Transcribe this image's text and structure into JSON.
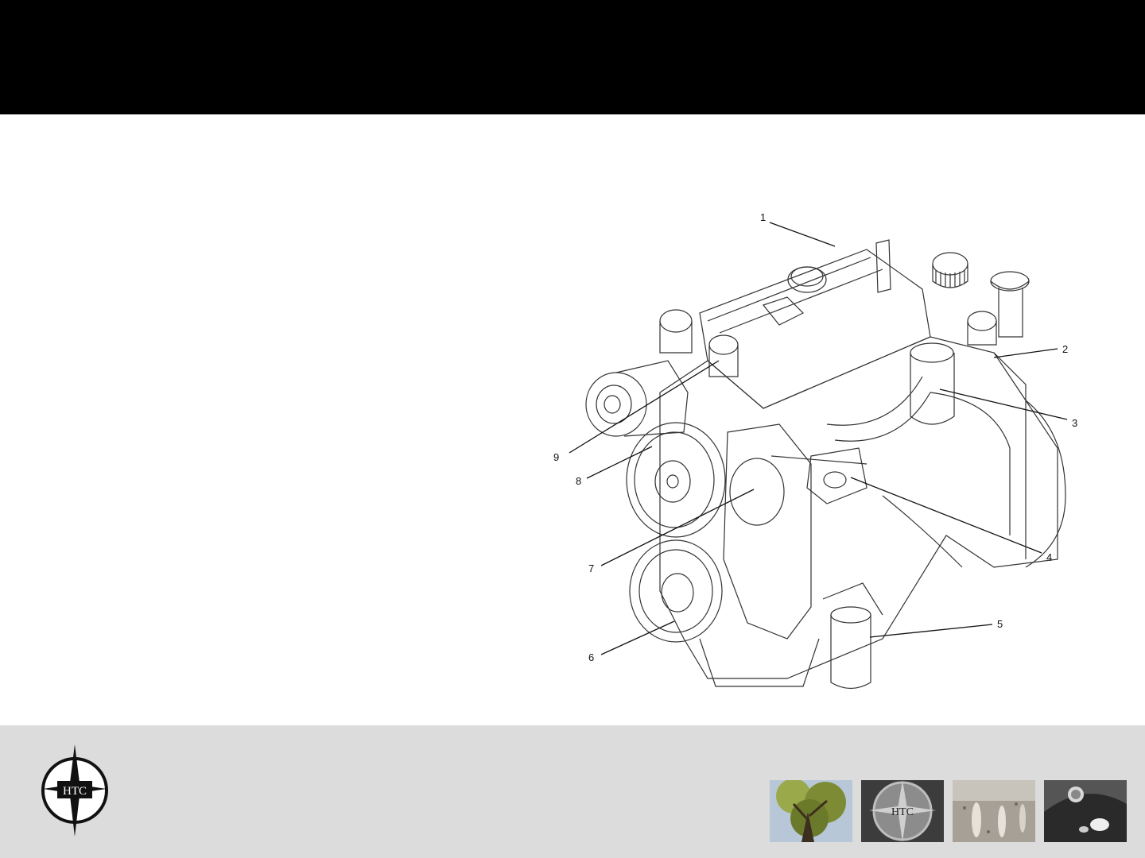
{
  "logo": {
    "text": "HTC"
  },
  "diagram": {
    "callouts": [
      "1",
      "2",
      "3",
      "4",
      "5",
      "6",
      "7",
      "8",
      "9"
    ]
  },
  "footer": {
    "thumbnails": [
      {
        "name": "tree-photo"
      },
      {
        "name": "htc-metal-logo-photo",
        "text": "HTC"
      },
      {
        "name": "polished-floor-photo"
      },
      {
        "name": "machine-detail-photo"
      }
    ]
  }
}
